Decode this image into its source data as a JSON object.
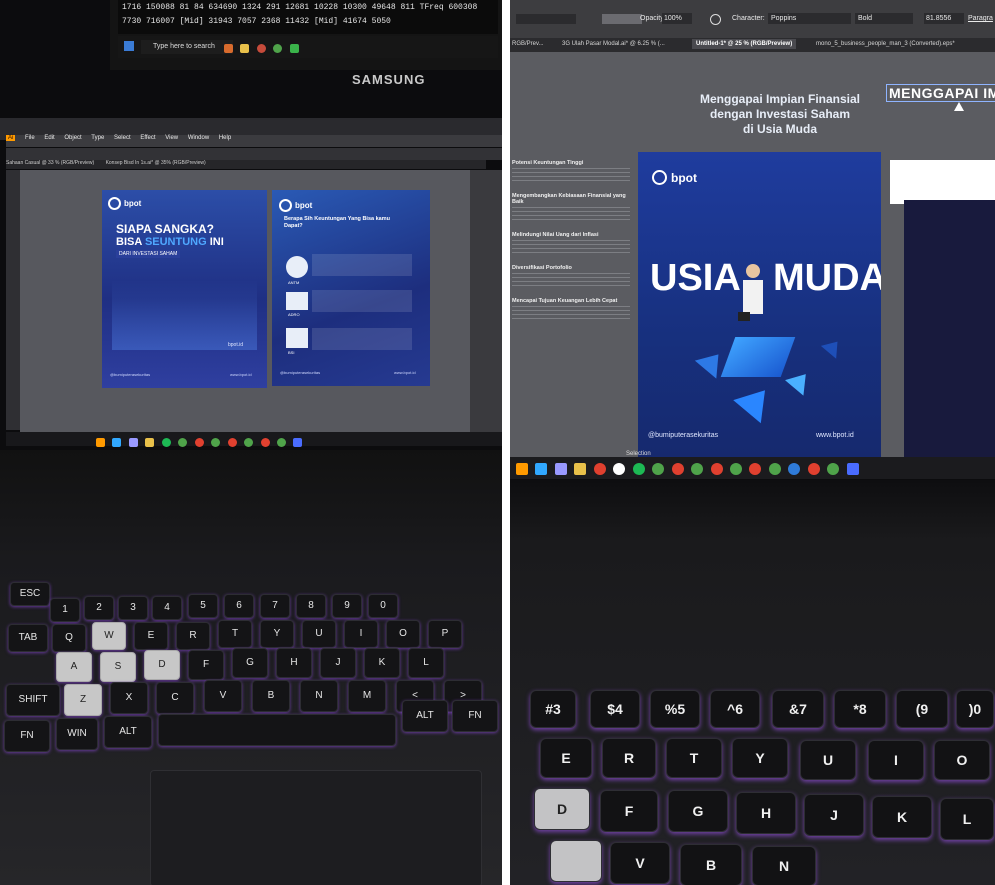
{
  "left_photo": {
    "monitor": {
      "ticker_rows": [
        "1716 150088   81   84 634690  1324   291 12681 10228 10300 49648 811  TFreq 600308",
        "7730 716007 [Mid]  31943   7057   2368 11432 [Mid]   41674  5050"
      ],
      "search_placeholder": "Type here to search",
      "brand": "SAMSUNG"
    },
    "illustrator": {
      "menu": [
        "Ai",
        "File",
        "Edit",
        "Object",
        "Type",
        "Select",
        "Effect",
        "View",
        "Window",
        "Help"
      ],
      "tabs": [
        "Sahaan Casual @ 33 % (RGB/Preview)",
        "Konsep Bisd In 1s.ai* @ 35% (RGB/Preview)"
      ]
    },
    "artboard_a": {
      "logo": "bpot",
      "headline_1": "SIAPA SANGKA?",
      "headline_2_pre": "BISA ",
      "headline_2_highlight": "SEUNTUNG",
      "headline_2_post": " INI",
      "subline": "DARI INVESTASI SAHAM",
      "footer_left": "@bumiputerasekuritas",
      "footer_right": "www.bpot.id",
      "brand_small": "bpot.id"
    },
    "artboard_b": {
      "logo": "bpot",
      "title": "Berapa Sih Keuntungan Yang Bisa kamu Dapat?",
      "footer_left": "@bumiputerasekuritas",
      "footer_right": "www.bpot.id",
      "stocks": [
        "ANTM",
        "ADRO",
        "BSI"
      ]
    },
    "keyboard": {
      "rows": [
        [
          "ESC",
          "1",
          "2",
          "3",
          "4",
          "5",
          "6",
          "7",
          "8",
          "9",
          "0"
        ],
        [
          "TAB",
          "Q",
          "W",
          "E",
          "R",
          "T",
          "Y",
          "U",
          "I",
          "O",
          "P"
        ],
        [
          "A",
          "S",
          "D",
          "F",
          "G",
          "H",
          "J",
          "K",
          "L"
        ],
        [
          "SHIFT",
          "Z",
          "X",
          "C",
          "V",
          "B",
          "N",
          "M",
          "<",
          ">"
        ],
        [
          "FN",
          "WIN",
          "ALT",
          "ALT",
          "FN"
        ]
      ]
    }
  },
  "right_photo": {
    "controls": {
      "opacity_label": "Opacity:",
      "opacity_value": "100%",
      "character_label": "Character:",
      "font_name": "Poppins",
      "font_weight": "Bold",
      "size_value": "81.8556",
      "paragraph_label": "Paragra"
    },
    "tabs": [
      "RGB/Prev...",
      "3G Ulah Pasar Modal.ai* @ 6.25 % (...",
      "Untitled-1* @ 25 % (RGB/Preview)",
      "mono_5_business_people_man_3 (Converted).eps*"
    ],
    "headline": [
      "Menggapai Impian Finansial",
      "dengan Investasi Saham",
      "di Usia Muda"
    ],
    "selected_text": "MENGGAPAI IM",
    "outline_items": [
      "Potensi Keuntungan Tinggi",
      "Mengembangkan Kebiasaan Finansial yang Baik",
      "Melindungi Nilai Uang dari Inflasi",
      "Diversifikasi Portofolio",
      "Mencapai Tujuan Keuangan Lebih Cepat"
    ],
    "poster": {
      "logo": "bpot",
      "word_left": "USIA",
      "word_right": "MUDA",
      "footer_left": "@bumiputerasekuritas",
      "footer_right": "www.bpot.id"
    },
    "taskbar_label": "Selection",
    "keyboard": {
      "rows": [
        [
          "#3",
          "$4",
          "%5",
          "^6",
          "&7",
          "*8",
          "(9",
          ")0"
        ],
        [
          "E",
          "R",
          "T",
          "Y",
          "U",
          "I",
          "O"
        ],
        [
          "D",
          "F",
          "G",
          "H",
          "J",
          "K",
          "L"
        ],
        [
          "V",
          "B",
          "N"
        ]
      ]
    }
  }
}
